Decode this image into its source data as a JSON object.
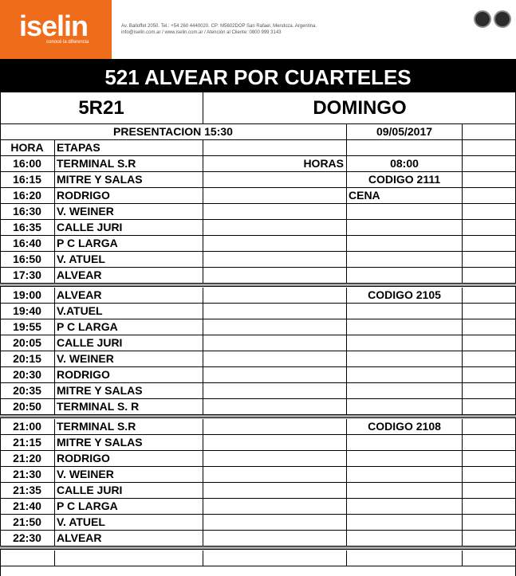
{
  "header": {
    "logo_text": "iselin",
    "logo_tagline": "conocé la diferencia",
    "address_line": "Av. Balloffet 2050. Tel.: +54 260 4440020. CP: M5602DOP San Rafael. Mendoza. Argentina.",
    "contact_line": "info@iselin.com.ar / www.iselin.com.ar / Atención al Cliente: 0800 999 3143"
  },
  "title": "521  ALVEAR POR CUARTELES",
  "service_code": "5R21",
  "day": "DOMINGO",
  "presentation": "PRESENTACION  15:30",
  "date": "09/05/2017",
  "columns": {
    "hora": "HORA",
    "etapas": "ETAPAS"
  },
  "horas_label": "HORAS",
  "horas_value": "08:00",
  "cena_label": "CENA",
  "blocks": [
    {
      "codigo": "CODIGO 2111",
      "rows": [
        {
          "hora": "16:00",
          "etapa": "TERMINAL  S.R"
        },
        {
          "hora": "16:15",
          "etapa": "MITRE Y SALAS"
        },
        {
          "hora": "16:20",
          "etapa": "RODRIGO"
        },
        {
          "hora": "16:30",
          "etapa": "V. WEINER"
        },
        {
          "hora": "16:35",
          "etapa": "CALLE JURI"
        },
        {
          "hora": "16:40",
          "etapa": "P C LARGA"
        },
        {
          "hora": "16:50",
          "etapa": "V. ATUEL"
        },
        {
          "hora": "17:30",
          "etapa": "ALVEAR"
        }
      ]
    },
    {
      "codigo": "CODIGO 2105",
      "rows": [
        {
          "hora": "19:00",
          "etapa": "ALVEAR"
        },
        {
          "hora": "19:40",
          "etapa": "V.ATUEL"
        },
        {
          "hora": "19:55",
          "etapa": "P C LARGA"
        },
        {
          "hora": "20:05",
          "etapa": "CALLE JURI"
        },
        {
          "hora": "20:15",
          "etapa": "V. WEINER"
        },
        {
          "hora": "20:30",
          "etapa": "RODRIGO"
        },
        {
          "hora": "20:35",
          "etapa": "MITRE Y SALAS"
        },
        {
          "hora": "20:50",
          "etapa": "TERMINAL  S. R"
        }
      ]
    },
    {
      "codigo": "CODIGO 2108",
      "rows": [
        {
          "hora": "21:00",
          "etapa": "TERMINAL  S.R"
        },
        {
          "hora": "21:15",
          "etapa": "MITRE Y SALAS"
        },
        {
          "hora": "21:20",
          "etapa": "RODRIGO"
        },
        {
          "hora": "21:30",
          "etapa": "V. WEINER"
        },
        {
          "hora": "21:35",
          "etapa": "CALLE JURI"
        },
        {
          "hora": "21:40",
          "etapa": "P C LARGA"
        },
        {
          "hora": "21:50",
          "etapa": "V. ATUEL"
        },
        {
          "hora": "22:30",
          "etapa": "ALVEAR"
        }
      ]
    }
  ]
}
